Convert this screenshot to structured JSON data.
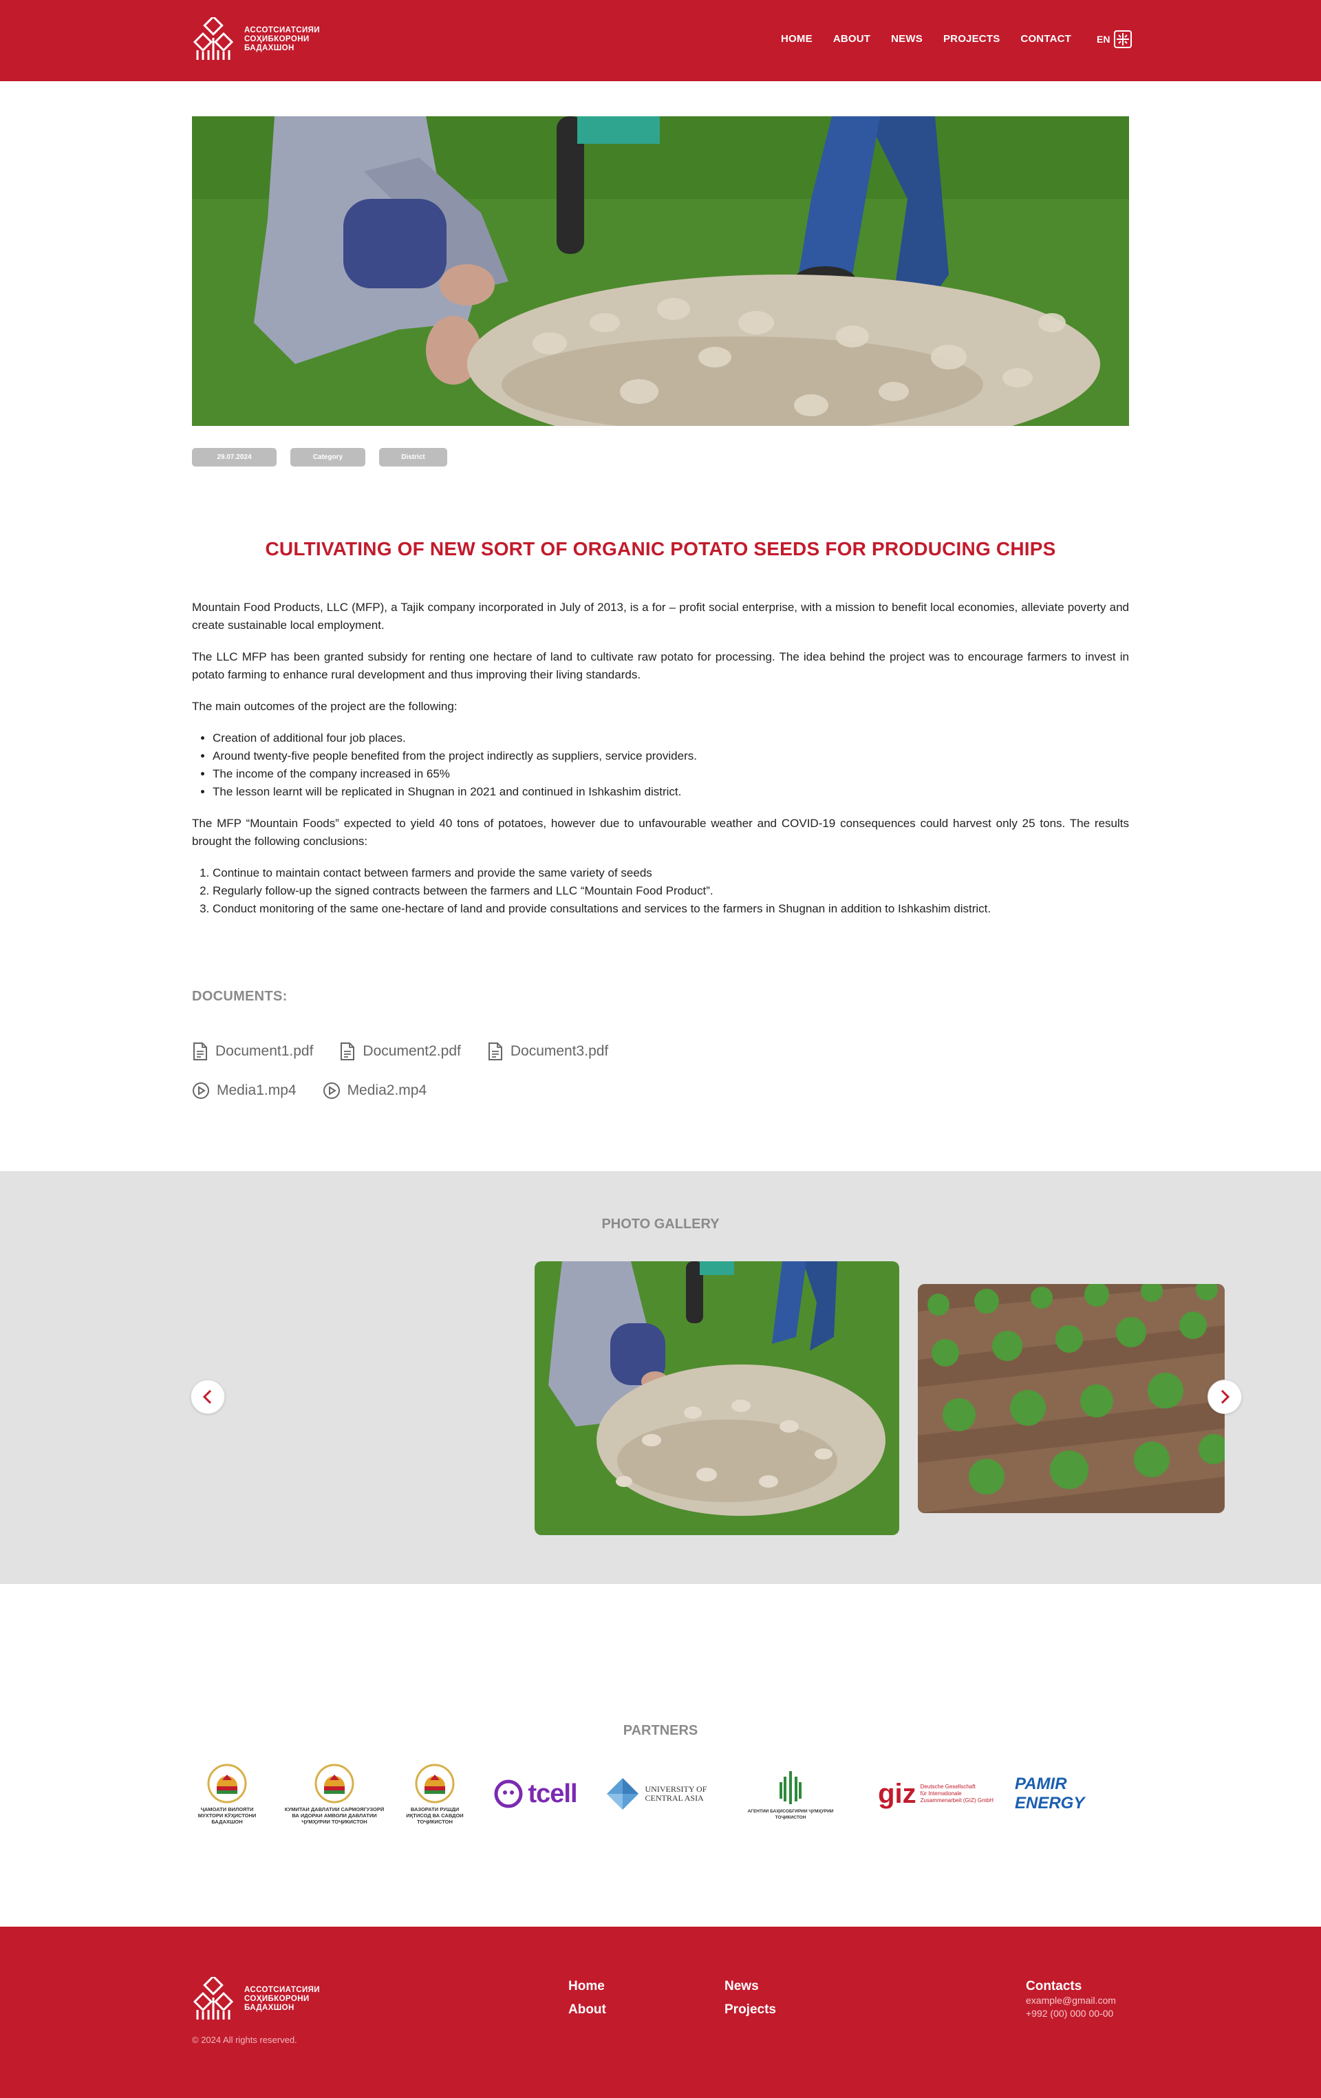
{
  "header": {
    "logo_lines": [
      "АССОТСИАТСИЯИ",
      "СОҲИБКОРОНИ",
      "БАДАХШОН"
    ],
    "nav": [
      "HOME",
      "ABOUT",
      "NEWS",
      "PROJECTS",
      "CONTACT"
    ],
    "lang": "EN"
  },
  "meta": {
    "date": "29.07.2024",
    "category": "Category",
    "district": "District"
  },
  "article": {
    "title": "CULTIVATING OF NEW SORT OF ORGANIC POTATO SEEDS FOR PRODUCING CHIPS",
    "p1": "Mountain Food Products, LLC (MFP), a Tajik company incorporated in July of 2013, is a for – profit social enterprise, with a mission to benefit local economies, alleviate poverty and create sustainable local employment.",
    "p2": "The LLC MFP has been granted subsidy for renting one hectare of land to cultivate raw potato for processing. The idea behind the project was to encourage farmers to invest in potato farming to enhance rural development and thus improving their living standards.",
    "p3": "The main outcomes of the project are the following:",
    "outcomes": [
      "Creation of additional four job places.",
      "Around twenty-five people benefited from the project indirectly as suppliers, service providers.",
      "The income of the company increased in 65%",
      "The lesson learnt will be replicated in Shugnan in 2021 and continued in Ishkashim district."
    ],
    "p4": "The MFP “Mountain Foods” expected to yield 40 tons of potatoes, however due to unfavourable weather and COVID-19 consequences could harvest only 25 tons. The results brought the following conclusions:",
    "conclusions": [
      "Continue to maintain contact between farmers and provide the same variety of seeds",
      "Regularly follow-up the signed contracts between the farmers and LLC “Mountain Food Product”.",
      "Conduct monitoring of the same one-hectare of land and provide consultations and services to the farmers in Shugnan in addition to Ishkashim district."
    ]
  },
  "documents": {
    "title": "DOCUMENTS:",
    "files": [
      "Document1.pdf",
      "Document2.pdf",
      "Document3.pdf"
    ],
    "media": [
      "Media1.mp4",
      "Media2.mp4"
    ]
  },
  "gallery": {
    "title": "PHOTO GALLERY"
  },
  "partners": {
    "title": "PARTNERS",
    "items": [
      {
        "text": "ҶАМОАТИ ВИЛОЯТИ МУХТОРИ КӮҲИСТОНИ БАДАХШОН"
      },
      {
        "text": "КУМИТАИ ДАВЛАТИИ САРМОЯГУЗОРӢ ВА ИДОРАИ АМВОЛИ ДАВЛАТИИ ҶУМҲУРИИ ТОҶИКИСТОН"
      },
      {
        "text": "ВАЗОРАТИ РУШДИ ИҚТИСОД ВА САВДОИ ТОҶИКИСТОН"
      },
      {
        "text": "tcell"
      },
      {
        "text": "UNIVERSITY OF CENTRAL ASIA"
      },
      {
        "text": "АГЕНТИИ БАҲИСОБГИРИИ ҶУМҲУРИИ ТОҶИКИСТОН"
      },
      {
        "text": "giz"
      },
      {
        "text": "PAMIR ENERGY"
      }
    ],
    "giz_sub": [
      "Deutsche Gesellschaft",
      "für Internationale",
      "Zusammenarbeit (GIZ) GmbH"
    ]
  },
  "footer": {
    "links_col1": [
      "Home",
      "About"
    ],
    "links_col2": [
      "News",
      "Projects"
    ],
    "contacts_title": "Contacts",
    "email": "example@gmail.com",
    "phone": "+992 (00) 000 00-00",
    "copyright": "© 2024 All rights reserved."
  },
  "colors": {
    "brand": "#c21b2c",
    "tag": "#bdbdbd",
    "gallery_bg": "#e2e2e2"
  }
}
